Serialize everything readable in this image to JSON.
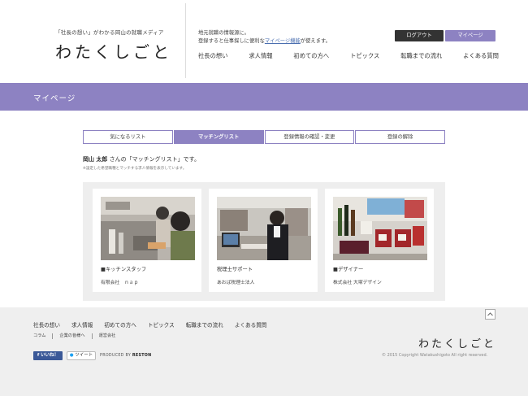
{
  "header": {
    "tagline": "「社長の想い」がわかる岡山の就職メディア",
    "logo": "わたくしごと",
    "intro_line1": "地元就職の情報源に。",
    "intro_line2_before": "登録すると仕事探しに便利な",
    "intro_link": "マイページ機能",
    "intro_line2_after": "が使えます。",
    "logout_label": "ログアウト",
    "mypage_label": "マイページ",
    "nav": [
      "社長の想い",
      "求人情報",
      "初めての方へ",
      "トピックス",
      "転職までの流れ",
      "よくある質問"
    ]
  },
  "banner": {
    "title": "マイページ"
  },
  "tabs": [
    {
      "label": "気になるリスト",
      "active": false
    },
    {
      "label": "マッチングリスト",
      "active": true
    },
    {
      "label": "登録情報の確認・変更",
      "active": false
    },
    {
      "label": "登録の解除",
      "active": false
    }
  ],
  "greeting": {
    "name": "岡山 太郎",
    "text": " さんの「マッチングリスト」です。",
    "note": "※設定した希望職種とマッチする求人情報を表示しています。"
  },
  "cards": [
    {
      "job": "■キッチンスタッフ",
      "company": "有限会社　ｎａｐ",
      "image": "kitchen-photo"
    },
    {
      "job": "税理士サポート",
      "company": "あおば税理士法人",
      "image": "office-photo"
    },
    {
      "job": "■デザイナー",
      "company": "株式会社 大塚デザイン",
      "image": "products-photo"
    }
  ],
  "footer": {
    "pagetop_icon": "chevron-up-icon",
    "nav": [
      "社長の想い",
      "求人情報",
      "初めての方へ",
      "トピックス",
      "転職までの流れ",
      "よくある質問"
    ],
    "subnav": [
      "コラム",
      "企業の皆様へ",
      "運営会社"
    ],
    "like_label": "いいね！",
    "tweet_label": "ツイート",
    "produced_label": "PRODUCED BY",
    "produced_brand": "RESTON",
    "logo": "わたくしごと",
    "copyright": "2015 Copyright Watakushigoto All right reserved."
  },
  "colors": {
    "accent": "#8d82c2",
    "dark": "#333333",
    "footer_bg": "#efefef"
  }
}
